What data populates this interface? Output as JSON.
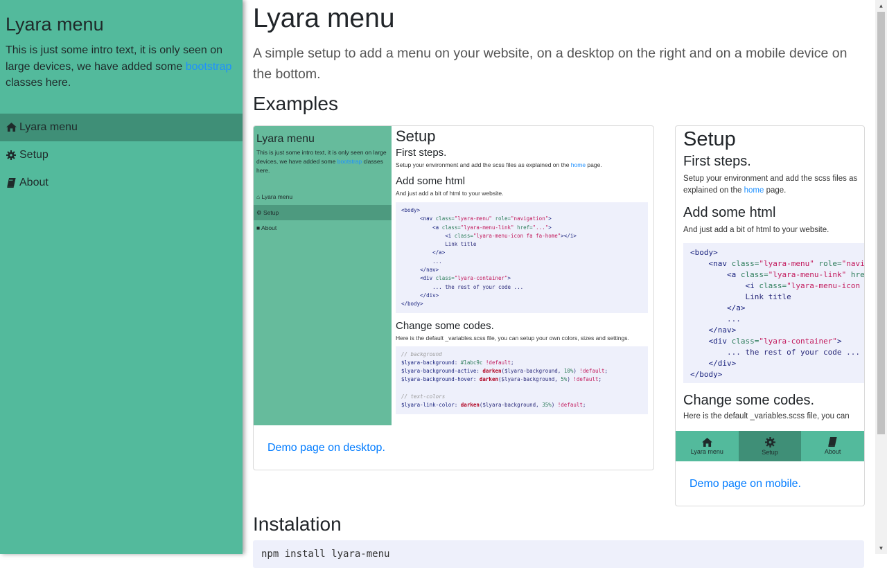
{
  "sidebar": {
    "title": "Lyara menu",
    "intro_before": "This is just some intro text, it is only seen on large devices, we have added some ",
    "intro_link": "bootstrap",
    "intro_after": " classes here.",
    "items": [
      {
        "label": "Lyara menu",
        "icon": "home-icon"
      },
      {
        "label": "Setup",
        "icon": "gear-icon"
      },
      {
        "label": "About",
        "icon": "book-icon"
      }
    ]
  },
  "main": {
    "title": "Lyara menu",
    "lead": "A simple setup to add a menu on your website, on a desktop on the right and on a mobile device on the bottom.",
    "examples_title": "Examples",
    "installation_title": "Instalation",
    "install_command": "npm install lyara-menu"
  },
  "desktop_preview": {
    "side_title": "Lyara menu",
    "side_intro_before": "This is just some intro text, it is only seen on large devices, we have added some ",
    "side_intro_link": "bootstrap",
    "side_intro_after": " classes here.",
    "nav": [
      "Lyara menu",
      "Setup",
      "About"
    ],
    "heading": "Setup",
    "first_steps": "First steps.",
    "first_steps_text_before": "Setup your environment and add the scss files as explained on the ",
    "first_steps_link": "home",
    "first_steps_text_after": " page.",
    "add_html": "Add some html",
    "add_html_text": "And just add a bit of html to your website.",
    "change_codes": "Change some codes.",
    "change_codes_text": "Here is the default _variables.scss file, you can setup your own colors, sizes and settings.",
    "caption": "Demo page on desktop."
  },
  "mobile_preview": {
    "heading": "Setup",
    "first_steps": "First steps.",
    "first_steps_text_before": "Setup your environment and add the scss files as explained on the ",
    "first_steps_link": "home",
    "first_steps_text_after": " page.",
    "add_html": "Add some html",
    "add_html_text": "And just add a bit of html to your website.",
    "change_codes": "Change some codes.",
    "change_codes_text": "Here is the default _variables.scss file, you can",
    "bar": [
      "Lyara menu",
      "Setup",
      "About"
    ],
    "caption": "Demo page on mobile."
  },
  "colors": {
    "sidebar_bg": "#53ba9c",
    "sidebar_active": "#3f8f77",
    "link": "#007bff",
    "code_bg": "#eef0fb"
  }
}
